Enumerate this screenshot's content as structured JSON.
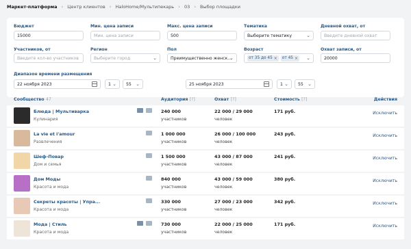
{
  "breadcrumb": [
    "Маркет-платформа",
    "Центр клиентов",
    "HaloHome/Мультипекарь",
    "03",
    "Выбор площадки"
  ],
  "filters": {
    "budget": {
      "label": "Бюджет",
      "value": "15000"
    },
    "min_price": {
      "label": "Мин. цена записи",
      "placeholder": "Мин. цена записи"
    },
    "max_price": {
      "label": "Макс. цена записи",
      "value": "500"
    },
    "topic": {
      "label": "Тематика",
      "value": "Выберите тематику"
    },
    "daily_reach": {
      "label": "Дневной охват, от",
      "placeholder": "Введите дневной охват"
    },
    "members": {
      "label": "Участников, от",
      "placeholder": "Введите кол-во участников"
    },
    "region": {
      "label": "Регион",
      "value": "Выберите город"
    },
    "gender": {
      "label": "Пол",
      "value": "Преимущественно женск..."
    },
    "age": {
      "label": "Возраст",
      "tags": [
        "от 35 до 45",
        "от 45"
      ]
    },
    "post_reach": {
      "label": "Охват записи, от",
      "value": "20000"
    },
    "time_range": {
      "label": "Диапазон времени размещения",
      "start_date": "22 ноября 2023",
      "start_hour": "1",
      "start_min": "55",
      "end_date": "25 ноября 2023",
      "end_hour": "1",
      "end_min": "55"
    }
  },
  "table": {
    "headers": {
      "community": "Сообщество",
      "community_count": "47",
      "audience": "Аудитория",
      "reach": "Охват",
      "cost": "Стоимость",
      "actions": "Действия",
      "help": "[?]"
    },
    "rows": [
      {
        "name": "Блюда | Мультиварка",
        "category": "Кулинария",
        "audience": "240 000",
        "audience_unit": "участников",
        "reach": "22 000 / 29 000",
        "reach_unit": "человек",
        "cost": "171 руб.",
        "action": "Исключить",
        "chat_icon": true,
        "avatar_color": "#2b2b2b",
        "avatar_icon": "cooking-logo-icon"
      },
      {
        "name": "La vie et l'amour",
        "category": "Развлечения",
        "audience": "1 000 000",
        "audience_unit": "участников",
        "reach": "26 000 / 100 000",
        "reach_unit": "человек",
        "cost": "243 руб.",
        "action": "Исключить",
        "chat_icon": false,
        "avatar_color": "#d9b99b",
        "avatar_icon": "woman-photo-icon"
      },
      {
        "name": "Шеф-Повар",
        "category": "Дом и семья",
        "audience": "1 500 000",
        "audience_unit": "участников",
        "reach": "43 000 / 87 000",
        "reach_unit": "человек",
        "cost": "241 руб.",
        "action": "Исключить",
        "chat_icon": false,
        "avatar_color": "#f1d7a8",
        "avatar_icon": "chef-logo-icon"
      },
      {
        "name": "Дом Моды",
        "category": "Красота и мода",
        "audience": "840 000",
        "audience_unit": "участников",
        "reach": "43 000 / 59 000",
        "reach_unit": "человек",
        "cost": "380 руб.",
        "action": "Исключить",
        "chat_icon": false,
        "avatar_color": "#b86fc6",
        "avatar_icon": "fashion-house-logo-icon"
      },
      {
        "name": "Секреты красоты | Упра...",
        "category": "Красота и мода",
        "audience": "330 000",
        "audience_unit": "участников",
        "reach": "27 000 / 23 000",
        "reach_unit": "человек",
        "cost": "342 руб.",
        "action": "Исключить",
        "chat_icon": false,
        "avatar_color": "#e8c9b5",
        "avatar_icon": "beauty-photo-icon"
      },
      {
        "name": "Мода | Стиль",
        "category": "Красота и мода",
        "audience": "730 000",
        "audience_unit": "участников",
        "reach": "22 000 / 25 000",
        "reach_unit": "человек",
        "cost": "171 руб.",
        "action": "Исключить",
        "chat_icon": true,
        "avatar_color": "#efe4d8",
        "avatar_icon": "style-logo-icon"
      }
    ]
  }
}
